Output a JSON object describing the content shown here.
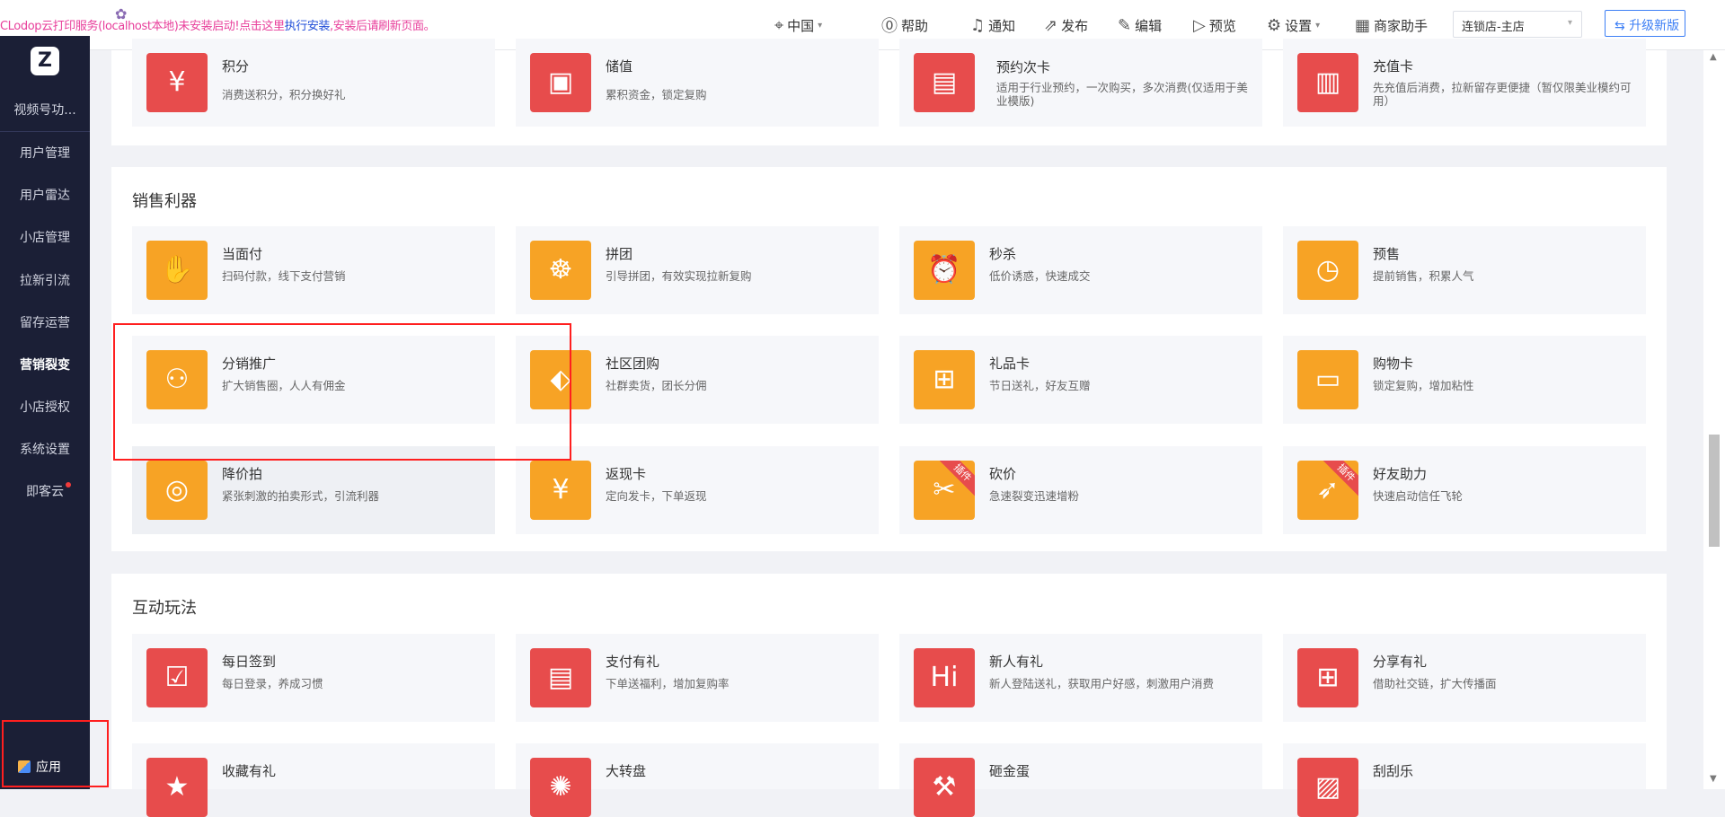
{
  "topbar": {
    "notice_prefix": "CLodop云打印服务(localhost本地)未安装启动!点击这里",
    "notice_link": "执行安装",
    "notice_suffix": ",安装后请刷新页面。",
    "region": "中国",
    "help": "帮助",
    "notify": "通知",
    "publish": "发布",
    "edit": "编辑",
    "preview": "预览",
    "settings": "设置",
    "merchant_assistant": "商家助手",
    "store_select": "连锁店-主店",
    "upgrade": "升级新版"
  },
  "sidebar": {
    "logo": "Z",
    "items": [
      {
        "label": "视频号功..."
      },
      {
        "label": "用户管理"
      },
      {
        "label": "用户雷达"
      },
      {
        "label": "小店管理"
      },
      {
        "label": "拉新引流"
      },
      {
        "label": "留存运营"
      },
      {
        "label": "营销裂变"
      },
      {
        "label": "小店授权"
      },
      {
        "label": "系统设置"
      },
      {
        "label": "即客云"
      }
    ],
    "apps": "应用"
  },
  "sections": {
    "top_cards": [
      {
        "title": "积分",
        "desc": "消费送积分，积分换好礼",
        "color": "#e74c4c",
        "icon": "coin-icon"
      },
      {
        "title": "储值",
        "desc": "累积资金，锁定复购",
        "color": "#e74c4c",
        "icon": "wallet-icon"
      },
      {
        "title": "预约次卡",
        "desc": "适用于行业预约，一次购买，多次消费(仅适用于美业模版)",
        "color": "#e74c4c",
        "icon": "appointment-card-icon"
      },
      {
        "title": "充值卡",
        "desc": "先充值后消费，拉新留存更便捷（暂仅限美业模约可用）",
        "color": "#e74c4c",
        "icon": "recharge-card-icon"
      }
    ],
    "sales": {
      "title": "销售利器",
      "cards": [
        {
          "title": "当面付",
          "desc": "扫码付款，线下支付营销",
          "icon": "hand-pay-icon"
        },
        {
          "title": "拼团",
          "desc": "引导拼团，有效实现拉新复购",
          "icon": "group-buy-icon"
        },
        {
          "title": "秒杀",
          "desc": "低价诱惑，快速成交",
          "icon": "alarm-clock-icon"
        },
        {
          "title": "预售",
          "desc": "提前销售，积累人气",
          "icon": "presale-bag-icon"
        },
        {
          "title": "分销推广",
          "desc": "扩大销售圈，人人有佣金",
          "icon": "distribution-icon"
        },
        {
          "title": "社区团购",
          "desc": "社群卖货，团长分佣",
          "icon": "price-tag-icon"
        },
        {
          "title": "礼品卡",
          "desc": "节日送礼，好友互赠",
          "icon": "gift-icon"
        },
        {
          "title": "购物卡",
          "desc": "锁定复购，增加粘性",
          "icon": "shopping-card-icon"
        },
        {
          "title": "降价拍",
          "desc": "紧张刺激的拍卖形式，引流利器",
          "icon": "price-drop-icon"
        },
        {
          "title": "返现卡",
          "desc": "定向发卡，下单返现",
          "icon": "cashback-card-icon"
        },
        {
          "title": "砍价",
          "desc": "急速裂变迅速增粉",
          "icon": "knife-icon",
          "badge": "插件"
        },
        {
          "title": "好友助力",
          "desc": "快速启动信任飞轮",
          "icon": "rocket-icon",
          "badge": "插件"
        }
      ]
    },
    "interactive": {
      "title": "互动玩法",
      "cards": [
        {
          "title": "每日签到",
          "desc": "每日登录，养成习惯",
          "icon": "calendar-check-icon"
        },
        {
          "title": "支付有礼",
          "desc": "下单送福利，增加复购率",
          "icon": "pay-gift-icon"
        },
        {
          "title": "新人有礼",
          "desc": "新人登陆送礼，获取用户好感，刺激用户消费",
          "icon": "new-user-gift-icon"
        },
        {
          "title": "分享有礼",
          "desc": "借助社交链，扩大传播面",
          "icon": "share-gift-icon"
        },
        {
          "title": "收藏有礼",
          "desc": "",
          "icon": "favorite-gift-icon"
        },
        {
          "title": "大转盘",
          "desc": "",
          "icon": "wheel-icon"
        },
        {
          "title": "砸金蛋",
          "desc": "",
          "icon": "hammer-icon"
        },
        {
          "title": "刮刮乐",
          "desc": "",
          "icon": "scratch-card-icon"
        }
      ]
    }
  },
  "colors": {
    "sidebar_bg": "#1b1f36",
    "red": "#e74c4c",
    "orange": "#f7a325",
    "accent_blue": "#3d7ff5",
    "highlight_box": "#ff1f1f"
  }
}
